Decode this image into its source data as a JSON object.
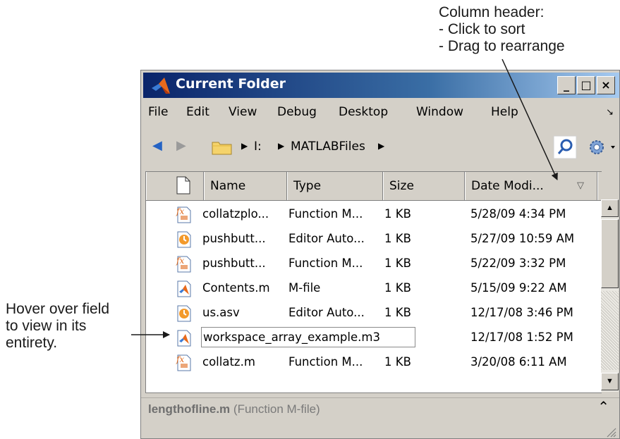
{
  "callouts": {
    "header": [
      "Column header:",
      "- Click to sort",
      "- Drag to rearrange"
    ],
    "hover": [
      "Hover over field",
      "to view in its",
      "entirety."
    ]
  },
  "window": {
    "title": "Current Folder",
    "controls": {
      "minimize": "_",
      "maximize": "□",
      "close": "×"
    }
  },
  "menu": [
    "File",
    "Edit",
    "View",
    "Debug",
    "Desktop",
    "Window",
    "Help"
  ],
  "address": {
    "segments": [
      "I:",
      "MATLABFiles"
    ]
  },
  "columns": [
    "Name",
    "Type",
    "Size",
    "Date Modi..."
  ],
  "sort_indicator": "▽",
  "rows": [
    {
      "icon": "function-file-icon",
      "name": "collatzplo...",
      "type": "Function M...",
      "size": "1 KB",
      "date": "5/28/09 4:34 PM"
    },
    {
      "icon": "autosave-file-icon",
      "name": "pushbutt...",
      "type": "Editor Auto...",
      "size": "1 KB",
      "date": "5/27/09 10:59 AM"
    },
    {
      "icon": "function-file-icon",
      "name": "pushbutt...",
      "type": "Function M...",
      "size": "1 KB",
      "date": "5/22/09 3:32 PM"
    },
    {
      "icon": "mfile-icon",
      "name": "Contents.m",
      "type": "M-file",
      "size": "1 KB",
      "date": "5/15/09 9:22 AM"
    },
    {
      "icon": "autosave-file-icon",
      "name": "us.asv",
      "type": "Editor Auto...",
      "size": "1 KB",
      "date": "12/17/08 3:46 PM"
    },
    {
      "icon": "mfile-icon",
      "name": "workspace_array_example.m",
      "hover_suffix": "3",
      "date": "12/17/08 1:52 PM"
    },
    {
      "icon": "function-file-icon",
      "name": "collatz.m",
      "type": "Function M...",
      "size": "1 KB",
      "date": "3/20/08 6:11 AM"
    }
  ],
  "details": {
    "filename": "lengthofline.m",
    "filetype": "(Function M-file)"
  },
  "colors": {
    "titlebar_start": "#0a246a",
    "titlebar_end": "#a6caf0",
    "chrome": "#d4d0c8"
  }
}
